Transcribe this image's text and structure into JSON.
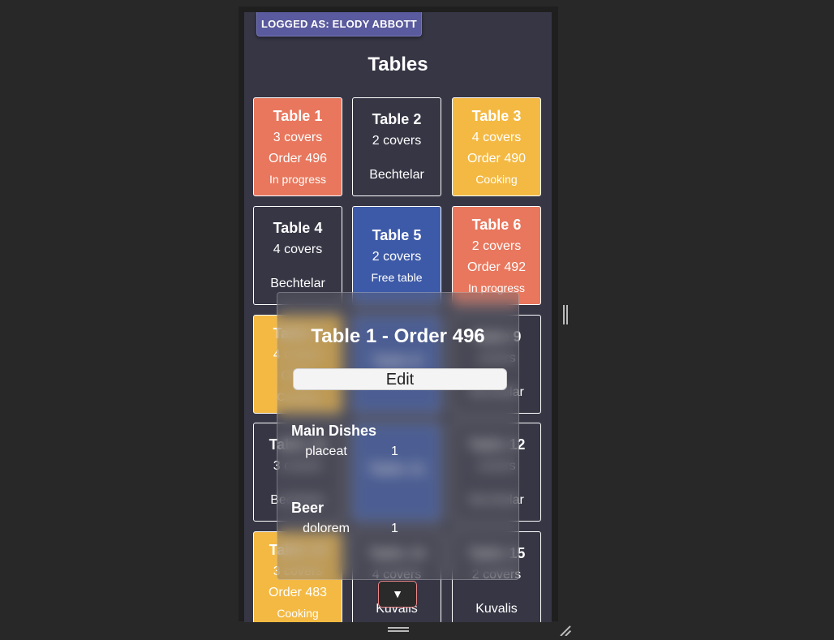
{
  "header": {
    "logged_as": "LOGGED AS: ELODY ABBOTT",
    "title": "Tables"
  },
  "colors": {
    "in_progress": "#e8775d",
    "cooking": "#f4b942",
    "free": "#3d5aa8",
    "idle": "#363645"
  },
  "tables": [
    {
      "name": "Table 1",
      "covers": "3 covers",
      "order": "Order 496",
      "status": "In progress",
      "waiter": "",
      "color": "red"
    },
    {
      "name": "Table 2",
      "covers": "2 covers",
      "order": "",
      "status": "",
      "waiter": "Bechtelar",
      "color": "dark"
    },
    {
      "name": "Table 3",
      "covers": "4 covers",
      "order": "Order 490",
      "status": "Cooking",
      "waiter": "",
      "color": "yellow"
    },
    {
      "name": "Table 4",
      "covers": "4 covers",
      "order": "",
      "status": "",
      "waiter": "Bechtelar",
      "color": "dark"
    },
    {
      "name": "Table 5",
      "covers": "2 covers",
      "order": "",
      "status": "Free table",
      "waiter": "",
      "color": "blue"
    },
    {
      "name": "Table 6",
      "covers": "2 covers",
      "order": "Order 492",
      "status": "In progress",
      "waiter": "",
      "color": "red"
    },
    {
      "name": "Table 7",
      "covers": "4 covers",
      "order": "Order",
      "status": "Cooking",
      "waiter": "",
      "color": "yellow"
    },
    {
      "name": "Table 8",
      "covers": "",
      "order": "",
      "status": "",
      "waiter": "",
      "color": "blue"
    },
    {
      "name": "Table 9",
      "covers": "covers",
      "order": "",
      "status": "",
      "waiter": "Bechtelar",
      "color": "dark"
    },
    {
      "name": "Table 10",
      "covers": "3 covers",
      "order": "",
      "status": "",
      "waiter": "Bechtelar",
      "color": "dark"
    },
    {
      "name": "Table 11",
      "covers": "",
      "order": "",
      "status": "",
      "waiter": "",
      "color": "blue"
    },
    {
      "name": "Table 12",
      "covers": "covers",
      "order": "",
      "status": "",
      "waiter": "Bechtelar",
      "color": "dark"
    },
    {
      "name": "Table 13",
      "covers": "3 covers",
      "order": "Order 483",
      "status": "Cooking",
      "waiter": "",
      "color": "yellow"
    },
    {
      "name": "Table 14",
      "covers": "4 covers",
      "order": "",
      "status": "",
      "waiter": "Kuvalis",
      "color": "dark"
    },
    {
      "name": "Table 15",
      "covers": "2 covers",
      "order": "",
      "status": "",
      "waiter": "Kuvalis",
      "color": "dark"
    }
  ],
  "popup": {
    "title": "Table 1 - Order 496",
    "edit_label": "Edit",
    "categories": [
      {
        "name": "Main Dishes",
        "items": [
          {
            "name": "placeat",
            "qty": "1"
          }
        ]
      },
      {
        "name": "Beer",
        "items": [
          {
            "name": "dolorem",
            "qty": "1"
          }
        ]
      }
    ]
  },
  "scroll_button": {
    "icon": "chevron-down-icon",
    "glyph": "▼"
  }
}
